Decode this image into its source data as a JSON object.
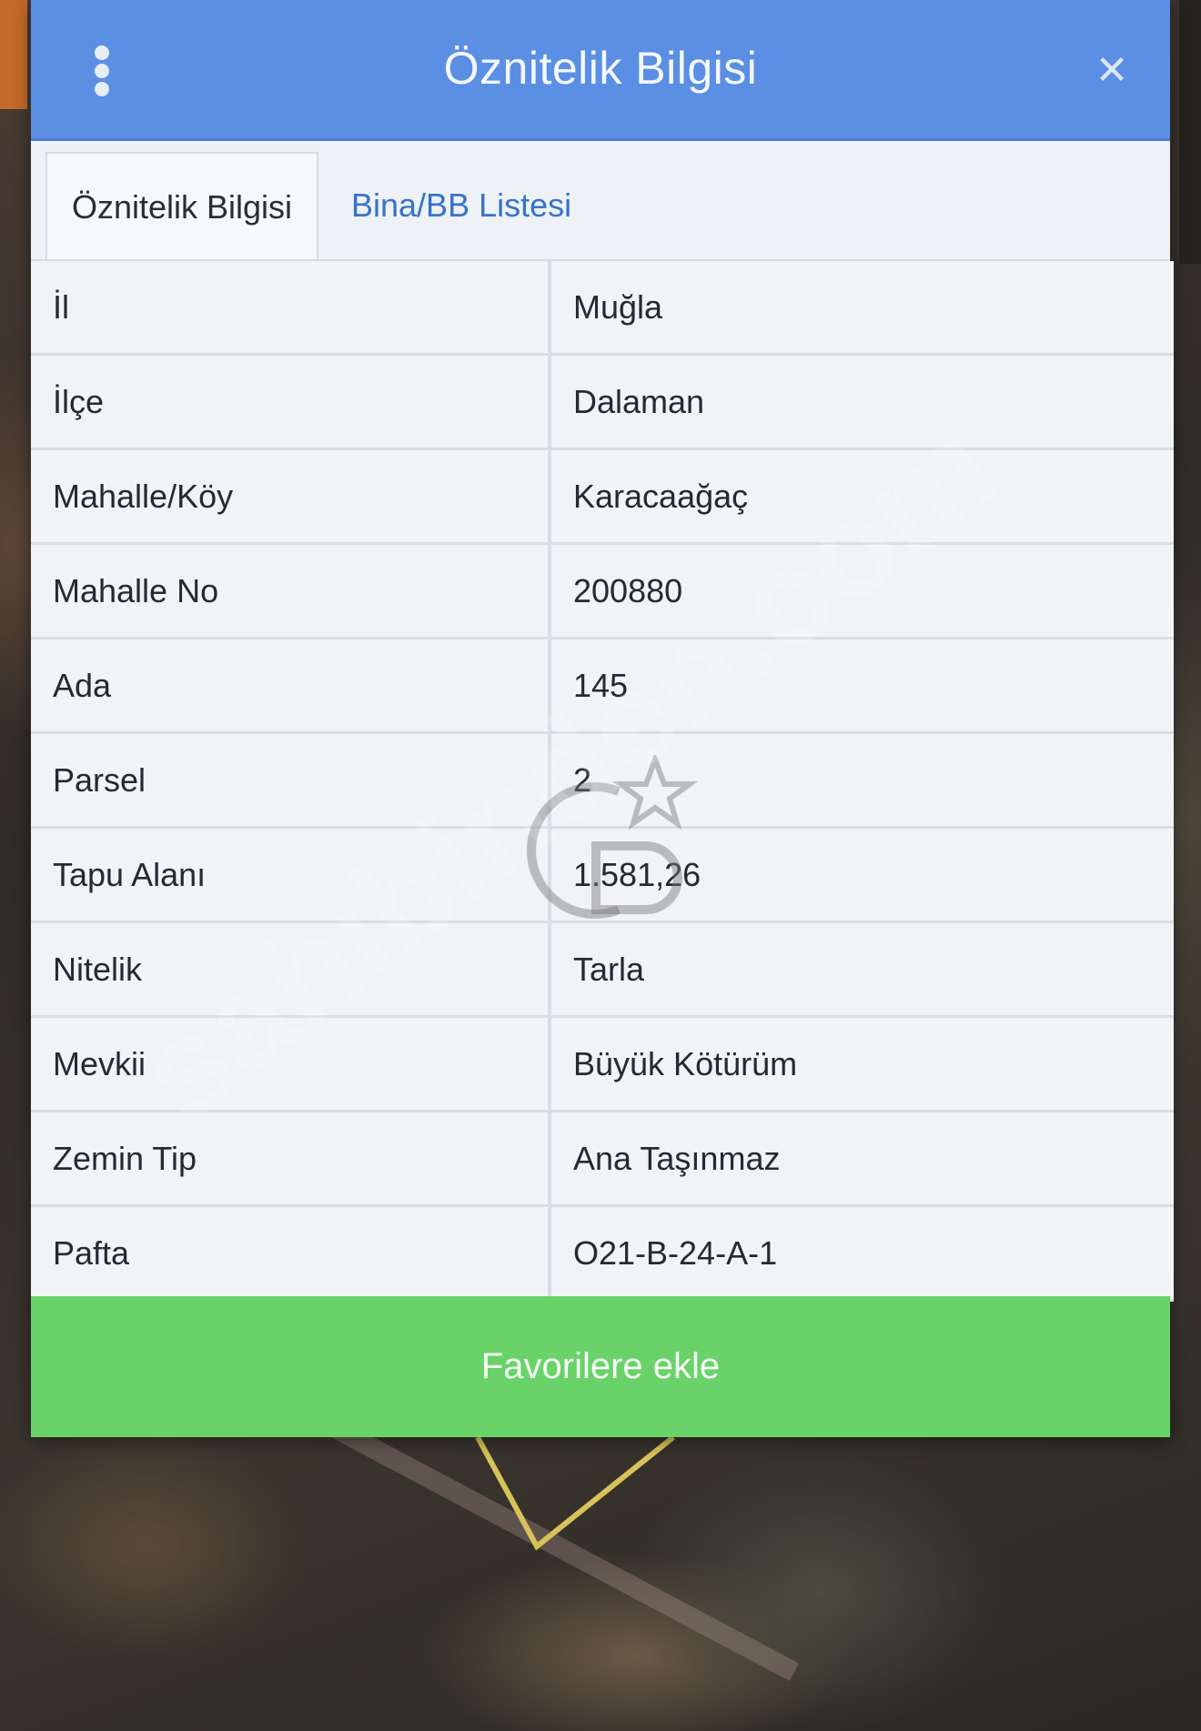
{
  "header": {
    "title": "Öznitelik Bilgisi"
  },
  "tabs": [
    {
      "label": "Öznitelik Bilgisi",
      "active": true
    },
    {
      "label": "Bina/BB Listesi",
      "active": false
    }
  ],
  "attributes": [
    {
      "label": "İl",
      "value": "Muğla"
    },
    {
      "label": "İlçe",
      "value": "Dalaman"
    },
    {
      "label": "Mahalle/Köy",
      "value": "Karacaağaç"
    },
    {
      "label": "Mahalle No",
      "value": "200880"
    },
    {
      "label": "Ada",
      "value": "145"
    },
    {
      "label": "Parsel",
      "value": "2"
    },
    {
      "label": "Tapu Alanı",
      "value": "1.581,26"
    },
    {
      "label": "Nitelik",
      "value": "Tarla"
    },
    {
      "label": "Mevkii",
      "value": "Büyük Kötürüm"
    },
    {
      "label": "Zemin Tip",
      "value": "Ana Taşınmaz"
    },
    {
      "label": "Pafta",
      "value": "O21-B-24-A-1"
    }
  ],
  "actions": {
    "favorite_label": "Favorilere ekle"
  },
  "watermark": {
    "text": "sahibinden.com"
  },
  "colors": {
    "header": "#5a8fe3",
    "favorite_button": "#69d269",
    "tab_link": "#3673c9",
    "parcel_outline": "#d8c25a"
  },
  "icons": {
    "menu": "kebab-menu-icon",
    "close": "close-icon"
  }
}
